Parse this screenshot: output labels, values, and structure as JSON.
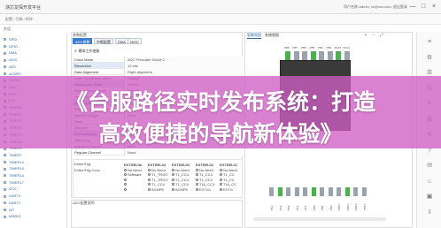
{
  "app": {
    "title": "测芯龙探开发平台",
    "user": "用户名称-Admin, xx@xxx.com, 退出登录",
    "window_controls": [
      "—",
      "□",
      "×"
    ]
  },
  "menubar": {
    "crumb": "配置 / 引脚 / 时钟"
  },
  "sidebar": {
    "header": "外设",
    "items": [
      "SPI0",
      "GPIO",
      "DMA",
      "NVIC",
      "ADC",
      "ACMP0",
      "ACMP1",
      "DAC",
      "CRC",
      "DIV",
      "TIMER0",
      "TIMER1",
      "TIMER2",
      "TIMER3",
      "TIMER4",
      "TIMER5",
      "TIMER6",
      "TIMER7",
      "TIMER14",
      "TIMER15",
      "TIMER16",
      "TIMER17",
      "I2C0",
      "UART0",
      "UART1",
      "WT",
      "WWDG"
    ]
  },
  "config_panel": {
    "title": "参数配置",
    "tabs": [
      {
        "label": "ADC参数",
        "active": true
      },
      {
        "label": "中断配置",
        "active": false
      },
      {
        "label": "DMA",
        "active": false
      },
      {
        "label": "NVIC",
        "active": false
      }
    ],
    "enable_checkbox": "模拟工作使能",
    "params": [
      {
        "name": "Clock Mode",
        "value": "ADC Prescaler Divide 2",
        "highlight": false
      },
      {
        "name": "Resolution",
        "value": "12 bits",
        "highlight": true
      },
      {
        "name": "Data Alignment",
        "value": "Right alignment",
        "highlight": false
      },
      {
        "name": "Scan Conversion Mode",
        "value": "Disable",
        "highlight": false
      },
      {
        "name": "Continuous Mode",
        "value": "Disable",
        "highlight": true
      },
      {
        "name": "Discontinuous Mode",
        "value": "Disable",
        "highlight": false
      },
      {
        "name": "Sampling Time",
        "value": "1.5 Cycles",
        "highlight": false
      },
      {
        "name": "Ext Trigger",
        "value": "Software",
        "highlight": true
      },
      {
        "name": "External Trigger Edge",
        "value": "None",
        "highlight": false
      },
      {
        "name": "Injected Trigger",
        "value": "None",
        "highlight": false
      },
      {
        "name": "Rank",
        "value": "1",
        "highlight": false
      },
      {
        "name": "Channel",
        "value": "Channel 0",
        "highlight": false
      },
      {
        "name": "Oversampling",
        "value": "Disable",
        "highlight": true
      },
      {
        "name": "Watchdog",
        "value": "Disable",
        "highlight": false
      },
      {
        "name": "Inserted Channel",
        "value": "None",
        "highlight": false
      },
      {
        "name": "Regular Channel",
        "value": "None",
        "highlight": false
      }
    ],
    "grid_label_1": "ExternTrig",
    "grid_label_2": "ExternTrig Conv",
    "grid_columns": [
      {
        "head": "EXTSEL0a",
        "cells": [
          "No Need",
          "Software",
          "",
          "",
          ""
        ]
      },
      {
        "head": "EXTSEL04",
        "cells": [
          "No Need",
          "T1_TRGO",
          "T1_TRGO",
          "T1_CC4",
          "ACMP5"
        ]
      },
      {
        "head": "EXTSEL03",
        "cells": [
          "No Need",
          "T1_CC4",
          "T1_CC4",
          "T1_CC4",
          "ACMP5"
        ]
      },
      {
        "head": "EXTSEL02",
        "cells": [
          "No Need",
          "T1_CC3",
          "T1_CC3",
          "T16_CC3",
          "EXTI11"
        ]
      },
      {
        "head": "EXTSEL01",
        "cells": [
          "No Need",
          "T1_CC",
          "T1_CC",
          "T16_CC",
          "EXTI1"
        ]
      }
    ],
    "lower_title": "ADC配置说明"
  },
  "pin_view": {
    "tabs": [
      {
        "label": "管脚视图",
        "active": true
      },
      {
        "label": "系统视图",
        "active": false
      }
    ],
    "zoom_tools": [
      "+",
      "−",
      "⤢"
    ],
    "top_pins": [
      "PB8",
      "PB7",
      "PB6",
      "PB5",
      "PB4",
      "PB3",
      "PA15",
      "PA14"
    ],
    "bottom_pins": [
      "PA3",
      "PA4",
      "PA5",
      "PA6",
      "PA7",
      "PB0",
      "PB1",
      "PB2",
      "PB10",
      "PB11",
      "PB12",
      "PB13"
    ]
  },
  "right_rail": {
    "icons": [
      "≡",
      "⚙",
      "☰",
      "⎘",
      "✎",
      "⊞",
      "↻",
      "?",
      "✉",
      "⌂",
      "▣",
      "⇩"
    ]
  },
  "banner": {
    "line1": "《台服路径实时发布系统：打造",
    "line2": "高效便捷的导航新体验》",
    "color": "#d05ec4"
  }
}
